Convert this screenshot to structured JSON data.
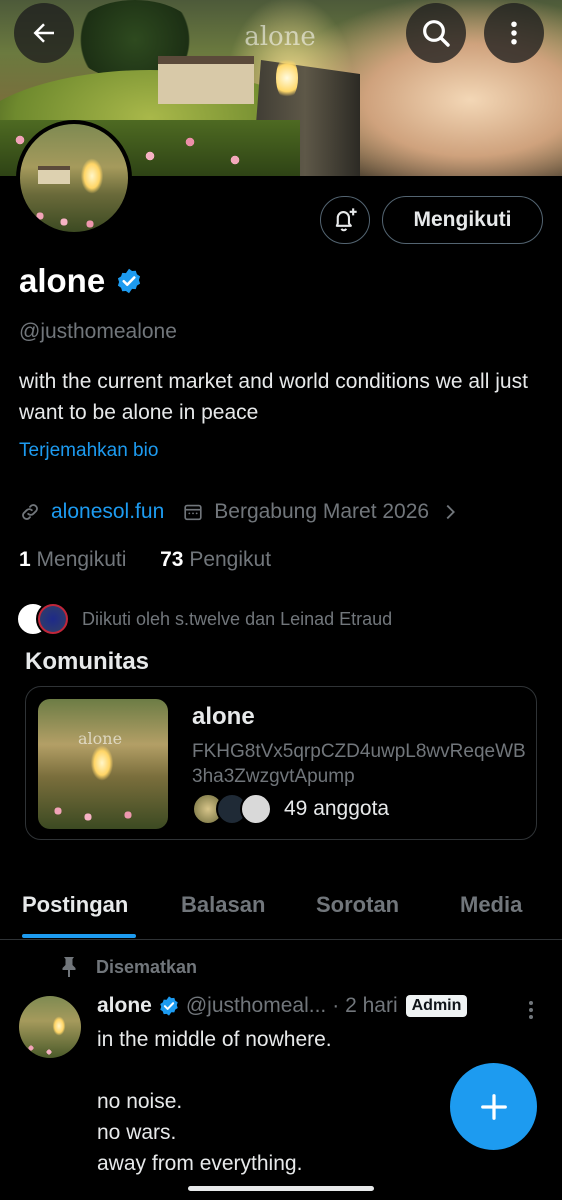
{
  "banner": {
    "overlay_text": "alone"
  },
  "profile": {
    "name": "alone",
    "handle": "@justhomealone",
    "bio": "with the current market and world conditions we all just want to be alone in peace",
    "translate_label": "Terjemahkan bio",
    "website": "alonesol.fun",
    "joined": "Bergabung Maret 2026",
    "following_count": "1",
    "following_label": "Mengikuti",
    "followers_count": "73",
    "followers_label": "Pengikut",
    "followed_by": "Diikuti oleh s.twelve dan Leinad Etraud"
  },
  "actions": {
    "follow_state": "Mengikuti"
  },
  "community": {
    "heading": "Komunitas",
    "name": "alone",
    "address": "FKHG8tVx5qrpCZD4uwpL8wvReqeWB3ha3ZwzgvtApump",
    "members": "49 anggota",
    "image_text": "alone"
  },
  "tabs": [
    {
      "label": "Postingan"
    },
    {
      "label": "Balasan"
    },
    {
      "label": "Sorotan"
    },
    {
      "label": "Media"
    }
  ],
  "post": {
    "pinned_label": "Disematkan",
    "author": "alone",
    "handle": "@justhomeal...",
    "time": "· 2 hari",
    "badge": "Admin",
    "body": "in the middle of nowhere.\n\nno noise.\nno wars.\naway from everything."
  },
  "colors": {
    "accent": "#1d9bf0",
    "background": "#000000",
    "muted": "#71767b"
  },
  "icons": [
    "back-arrow-icon",
    "search-icon",
    "more-vertical-icon",
    "bell-plus-icon",
    "verified-badge-icon",
    "link-icon",
    "calendar-icon",
    "chevron-right-icon",
    "pin-icon",
    "plus-icon"
  ]
}
